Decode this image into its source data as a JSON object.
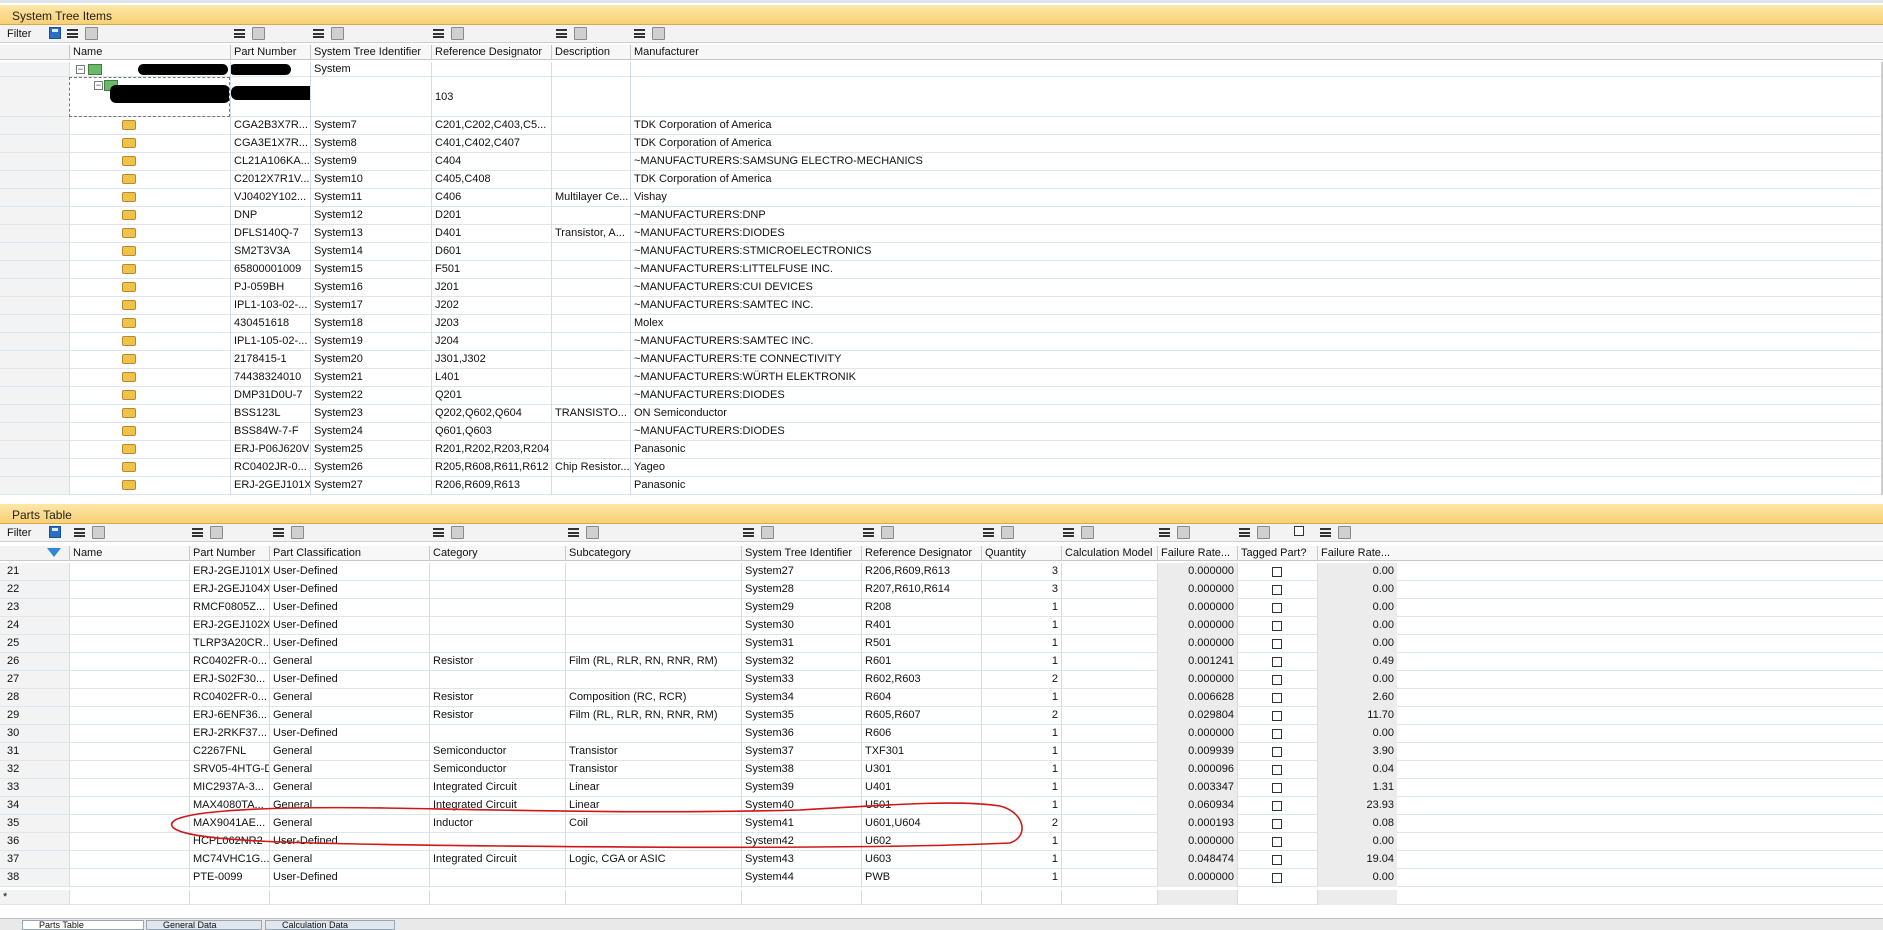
{
  "system_tree": {
    "title": "System Tree Items",
    "filter_label": "Filter",
    "columns": [
      "Name",
      "Part Number",
      "System Tree Identifier",
      "Reference Designator",
      "Description",
      "Manufacturer"
    ],
    "root": {
      "system_id": "System"
    },
    "child": {
      "ref": "103"
    },
    "rows": [
      {
        "part": "CGA2B3X7R...",
        "sys": "System7",
        "ref": "C201,C202,C403,C5...",
        "desc": "",
        "mfr": "TDK Corporation of America"
      },
      {
        "part": "CGA3E1X7R...",
        "sys": "System8",
        "ref": "C401,C402,C407",
        "desc": "",
        "mfr": "TDK Corporation of America"
      },
      {
        "part": "CL21A106KA...",
        "sys": "System9",
        "ref": "C404",
        "desc": "",
        "mfr": "~MANUFACTURERS:SAMSUNG ELECTRO-MECHANICS"
      },
      {
        "part": "C2012X7R1V...",
        "sys": "System10",
        "ref": "C405,C408",
        "desc": "",
        "mfr": "TDK Corporation of America"
      },
      {
        "part": "VJ0402Y102...",
        "sys": "System11",
        "ref": "C406",
        "desc": "Multilayer Ce...",
        "mfr": "Vishay"
      },
      {
        "part": "DNP",
        "sys": "System12",
        "ref": "D201",
        "desc": "",
        "mfr": "~MANUFACTURERS:DNP"
      },
      {
        "part": "DFLS140Q-7",
        "sys": "System13",
        "ref": "D401",
        "desc": "Transistor, A...",
        "mfr": "~MANUFACTURERS:DIODES"
      },
      {
        "part": "SM2T3V3A",
        "sys": "System14",
        "ref": "D601",
        "desc": "",
        "mfr": "~MANUFACTURERS:STMICROELECTRONICS"
      },
      {
        "part": "65800001009",
        "sys": "System15",
        "ref": "F501",
        "desc": "",
        "mfr": "~MANUFACTURERS:LITTELFUSE INC."
      },
      {
        "part": "PJ-059BH",
        "sys": "System16",
        "ref": "J201",
        "desc": "",
        "mfr": "~MANUFACTURERS:CUI DEVICES"
      },
      {
        "part": "IPL1-103-02-...",
        "sys": "System17",
        "ref": "J202",
        "desc": "",
        "mfr": "~MANUFACTURERS:SAMTEC INC."
      },
      {
        "part": "430451618",
        "sys": "System18",
        "ref": "J203",
        "desc": "",
        "mfr": "Molex"
      },
      {
        "part": "IPL1-105-02-...",
        "sys": "System19",
        "ref": "J204",
        "desc": "",
        "mfr": "~MANUFACTURERS:SAMTEC INC."
      },
      {
        "part": "2178415-1",
        "sys": "System20",
        "ref": "J301,J302",
        "desc": "",
        "mfr": "~MANUFACTURERS:TE CONNECTIVITY"
      },
      {
        "part": "74438324010",
        "sys": "System21",
        "ref": "L401",
        "desc": "",
        "mfr": "~MANUFACTURERS:WÜRTH ELEKTRONIK"
      },
      {
        "part": "DMP31D0U-7",
        "sys": "System22",
        "ref": "Q201",
        "desc": "",
        "mfr": "~MANUFACTURERS:DIODES"
      },
      {
        "part": "BSS123L",
        "sys": "System23",
        "ref": "Q202,Q602,Q604",
        "desc": "TRANSISTO...",
        "mfr": "ON Semiconductor"
      },
      {
        "part": "BSS84W-7-F",
        "sys": "System24",
        "ref": "Q601,Q603",
        "desc": "",
        "mfr": "~MANUFACTURERS:DIODES"
      },
      {
        "part": "ERJ-P06J620V",
        "sys": "System25",
        "ref": "R201,R202,R203,R204",
        "desc": "",
        "mfr": "Panasonic"
      },
      {
        "part": "RC0402JR-0...",
        "sys": "System26",
        "ref": "R205,R608,R611,R612",
        "desc": "Chip Resistor...",
        "mfr": "Yageo"
      },
      {
        "part": "ERJ-2GEJ101X",
        "sys": "System27",
        "ref": "R206,R609,R613",
        "desc": "",
        "mfr": "Panasonic"
      }
    ]
  },
  "parts_table": {
    "title": "Parts Table",
    "filter_label": "Filter",
    "columns": [
      "Name",
      "Part Number",
      "Part Classification",
      "Category",
      "Subcategory",
      "System Tree Identifier",
      "Reference Designator",
      "Quantity",
      "Calculation Model",
      "Failure Rate...",
      "Tagged Part?",
      "Failure Rate..."
    ],
    "rows": [
      {
        "n": "21",
        "part": "ERJ-2GEJ101X",
        "cls": "User-Defined",
        "cat": "",
        "sub": "",
        "sys": "System27",
        "ref": "R206,R609,R613",
        "qty": "3",
        "fr": "0.000000",
        "fr2": "0.00"
      },
      {
        "n": "22",
        "part": "ERJ-2GEJ104X",
        "cls": "User-Defined",
        "cat": "",
        "sub": "",
        "sys": "System28",
        "ref": "R207,R610,R614",
        "qty": "3",
        "fr": "0.000000",
        "fr2": "0.00"
      },
      {
        "n": "23",
        "part": "RMCF0805Z...",
        "cls": "User-Defined",
        "cat": "",
        "sub": "",
        "sys": "System29",
        "ref": "R208",
        "qty": "1",
        "fr": "0.000000",
        "fr2": "0.00"
      },
      {
        "n": "24",
        "part": "ERJ-2GEJ102X",
        "cls": "User-Defined",
        "cat": "",
        "sub": "",
        "sys": "System30",
        "ref": "R401",
        "qty": "1",
        "fr": "0.000000",
        "fr2": "0.00"
      },
      {
        "n": "25",
        "part": "TLRP3A20CR...",
        "cls": "User-Defined",
        "cat": "",
        "sub": "",
        "sys": "System31",
        "ref": "R501",
        "qty": "1",
        "fr": "0.000000",
        "fr2": "0.00"
      },
      {
        "n": "26",
        "part": "RC0402FR-0...",
        "cls": "General",
        "cat": "Resistor",
        "sub": "Film (RL, RLR, RN, RNR, RM)",
        "sys": "System32",
        "ref": "R601",
        "qty": "1",
        "fr": "0.001241",
        "fr2": "0.49"
      },
      {
        "n": "27",
        "part": "ERJ-S02F30...",
        "cls": "User-Defined",
        "cat": "",
        "sub": "",
        "sys": "System33",
        "ref": "R602,R603",
        "qty": "2",
        "fr": "0.000000",
        "fr2": "0.00"
      },
      {
        "n": "28",
        "part": "RC0402FR-0...",
        "cls": "General",
        "cat": "Resistor",
        "sub": "Composition (RC, RCR)",
        "sys": "System34",
        "ref": "R604",
        "qty": "1",
        "fr": "0.006628",
        "fr2": "2.60"
      },
      {
        "n": "29",
        "part": "ERJ-6ENF36...",
        "cls": "General",
        "cat": "Resistor",
        "sub": "Film (RL, RLR, RN, RNR, RM)",
        "sys": "System35",
        "ref": "R605,R607",
        "qty": "2",
        "fr": "0.029804",
        "fr2": "11.70"
      },
      {
        "n": "30",
        "part": "ERJ-2RKF37...",
        "cls": "User-Defined",
        "cat": "",
        "sub": "",
        "sys": "System36",
        "ref": "R606",
        "qty": "1",
        "fr": "0.000000",
        "fr2": "0.00"
      },
      {
        "n": "31",
        "part": "C2267FNL",
        "cls": "General",
        "cat": "Semiconductor",
        "sub": "Transistor",
        "sys": "System37",
        "ref": "TXF301",
        "qty": "1",
        "fr": "0.009939",
        "fr2": "3.90"
      },
      {
        "n": "32",
        "part": "SRV05-4HTG-D",
        "cls": "General",
        "cat": "Semiconductor",
        "sub": "Transistor",
        "sys": "System38",
        "ref": "U301",
        "qty": "1",
        "fr": "0.000096",
        "fr2": "0.04"
      },
      {
        "n": "33",
        "part": "MIC2937A-3...",
        "cls": "General",
        "cat": "Integrated Circuit",
        "sub": "Linear",
        "sys": "System39",
        "ref": "U401",
        "qty": "1",
        "fr": "0.003347",
        "fr2": "1.31"
      },
      {
        "n": "34",
        "part": "MAX4080TA...",
        "cls": "General",
        "cat": "Integrated Circuit",
        "sub": "Linear",
        "sys": "System40",
        "ref": "U501",
        "qty": "1",
        "fr": "0.060934",
        "fr2": "23.93"
      },
      {
        "n": "35",
        "part": "MAX9041AE...",
        "cls": "General",
        "cat": "Inductor",
        "sub": "Coil",
        "sys": "System41",
        "ref": "U601,U604",
        "qty": "2",
        "fr": "0.000193",
        "fr2": "0.08"
      },
      {
        "n": "36",
        "part": "HCPL062NR2",
        "cls": "User-Defined",
        "cat": "",
        "sub": "",
        "sys": "System42",
        "ref": "U602",
        "qty": "1",
        "fr": "0.000000",
        "fr2": "0.00"
      },
      {
        "n": "37",
        "part": "MC74VHC1G...",
        "cls": "General",
        "cat": "Integrated Circuit",
        "sub": "Logic, CGA or ASIC",
        "sys": "System43",
        "ref": "U603",
        "qty": "1",
        "fr": "0.048474",
        "fr2": "19.04"
      },
      {
        "n": "38",
        "part": "PTE-0099",
        "cls": "User-Defined",
        "cat": "",
        "sub": "",
        "sys": "System44",
        "ref": "PWB",
        "qty": "1",
        "fr": "0.000000",
        "fr2": "0.00"
      }
    ],
    "new_row_marker": "*"
  },
  "bottom_tabs": [
    "Parts Table",
    "General Data",
    "Calculation Data"
  ],
  "colors": {
    "header_orange": "#f8d074",
    "highlight_red": "#d01818",
    "leaf": "#f0c24a"
  }
}
